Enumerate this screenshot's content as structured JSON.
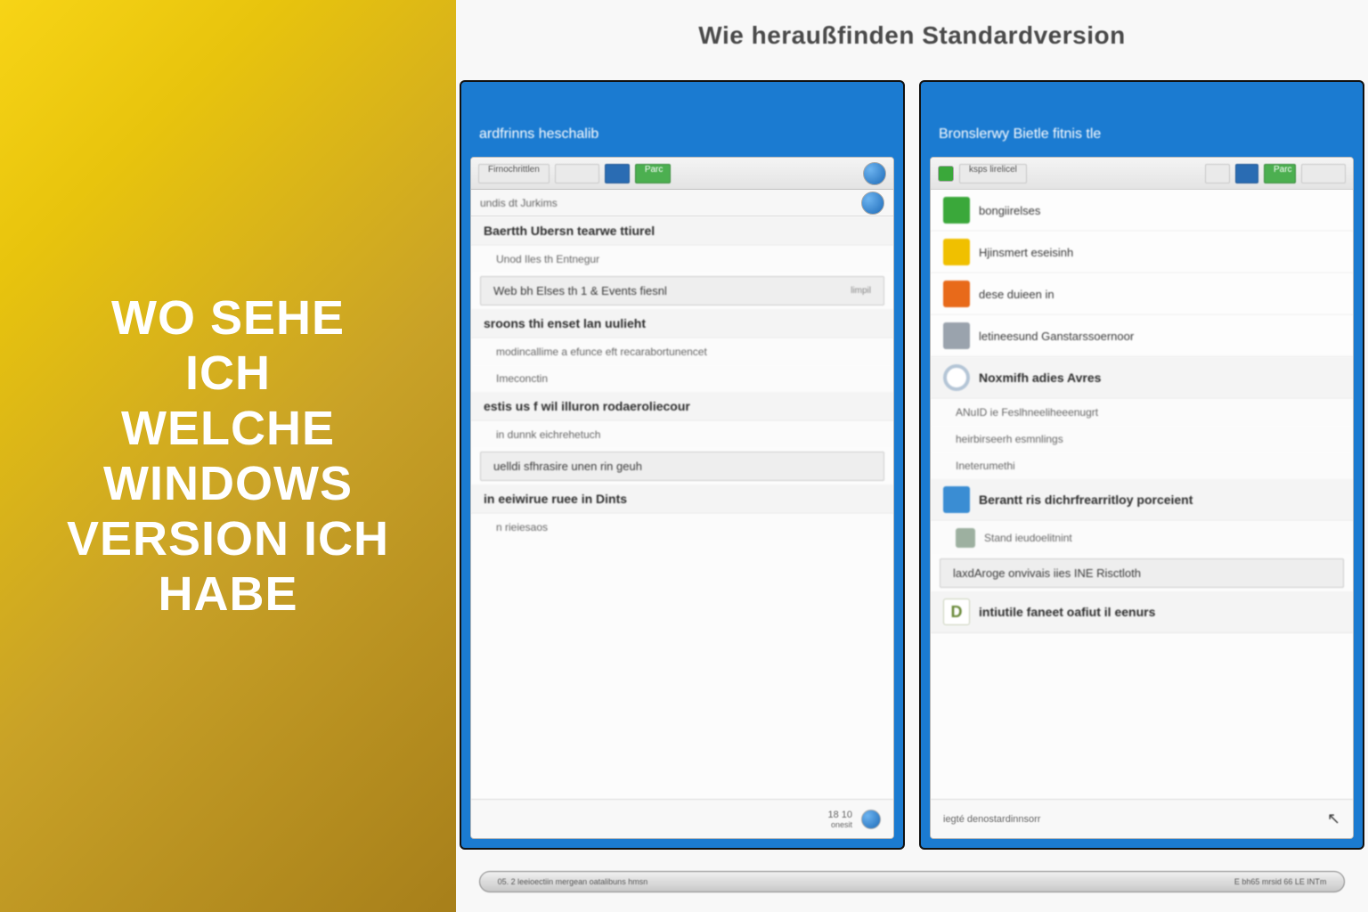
{
  "banner": {
    "line1": "WO SEHE ICH",
    "line2": "WELCHE",
    "line3": "WINDOWS",
    "line4": "VERSION ICH",
    "line5": "HABE"
  },
  "caption": "Wie heraußfinden Standardversion",
  "screen_left": {
    "title": "ardfrinns heschalib",
    "toolbar": {
      "btn1": "Firnochrittlen",
      "btn2": "",
      "btn3": "Parc"
    },
    "sub": "undis dt Jurkims",
    "rows": [
      "Baertth Ubersn tearwe ttiurel",
      "Unod Iles th Entnegur",
      "Web bh Elses th 1 & Events fiesnl",
      "sroons thi enset lan uulieht",
      "modincallime a efunce eft recarabortunencet",
      "Imeconctin",
      "estis us f wil illuron rodaeroliecour",
      "in dunnk eichrehetuch",
      "uelldi sfhrasire unen rin geuh",
      "in eeiwirue ruee in Dints",
      "n rieiesaos"
    ],
    "footer": {
      "label": "18 10",
      "sub": "onesit"
    }
  },
  "screen_right": {
    "title": "Bronslerwy Bietle fitnis tle",
    "toolbar": {
      "btn1": "ksps lirelicel",
      "btn2": "",
      "btn3": "Parc"
    },
    "rows": [
      {
        "text": "bongiirelses"
      },
      {
        "text": "Hjinsmert eseisinh"
      },
      {
        "text": "dese duieen in"
      },
      {
        "text": "letineesund Ganstarssoernoor"
      },
      {
        "text": "Noxmifh adies Avres"
      },
      {
        "text": "ANuID ie Feslhneeliheeenugrt"
      },
      {
        "text": "heirbirseerh esmnlings"
      },
      {
        "text": "Ineterumethi"
      },
      {
        "text": "Berantt ris dichrfrearritloy porceient"
      },
      {
        "text": "Stand ieudoelitnint"
      },
      {
        "text": "laxdAroge onvivais iies INE Risctloth"
      },
      {
        "text": "intiutile faneet oafiut il eenurs"
      }
    ],
    "footer": "iegté denostardinnsorr"
  },
  "stand": {
    "left": "05. 2 leeioectiin mergean oatalibuns hmsn",
    "right": "E bh65 mrsid 66 LE INTm"
  }
}
